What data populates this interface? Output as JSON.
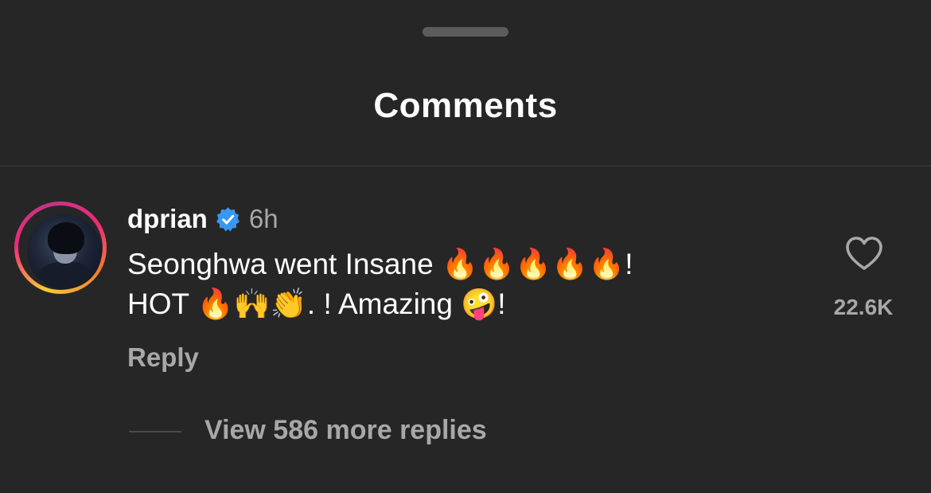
{
  "sheet": {
    "title": "Comments"
  },
  "comment": {
    "username": "dprian",
    "verified": true,
    "time": "6h",
    "text": "Seonghwa went Insane 🔥🔥🔥🔥🔥!\nHOT 🔥🙌👏. ! Amazing 🤪!",
    "reply_label": "Reply",
    "like_count": "22.6K",
    "view_replies_label": "View 586 more replies"
  },
  "icons": {
    "verified": "verified-badge-icon",
    "like": "heart-outline-icon",
    "avatar": "profile-photo"
  },
  "colors": {
    "background": "#262626",
    "secondary_text": "#a8a8a8",
    "verified_blue": "#3897f0",
    "story_ring_start": "#f9ce34",
    "story_ring_end": "#ee2a7b"
  }
}
